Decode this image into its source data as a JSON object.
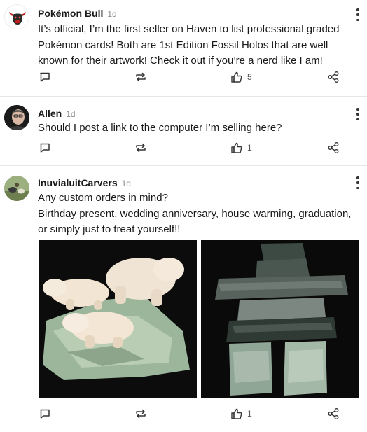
{
  "posts": [
    {
      "author": "Pokémon Bull",
      "time": "1d",
      "text": "It’s official, I’m the first seller on Haven to list professional graded Pokémon cards! Both are 1st Edition Fossil Holos that are well known for their artwork! Check it out if you’re a nerd like I am!",
      "likes": "5"
    },
    {
      "author": "Allen",
      "time": "1d",
      "text": "Should I post a link to the computer I’m selling here?",
      "likes": "1"
    },
    {
      "author": "InuvialuitCarvers",
      "time": "1d",
      "text_line1": "Any custom orders in mind?",
      "text_line2": "Birthday present, wedding anniversary, house warming, graduation, or simply just to treat yourself!!",
      "likes": "1"
    }
  ],
  "icons": {
    "comment": "comment-icon",
    "repost": "repost-icon",
    "like": "thumbs-up-icon",
    "share": "share-icon",
    "more": "more-vertical-icon"
  },
  "colors": {
    "bull_red": "#c0201a",
    "divider": "#e6e6e6",
    "muted": "#8a8a8a"
  }
}
